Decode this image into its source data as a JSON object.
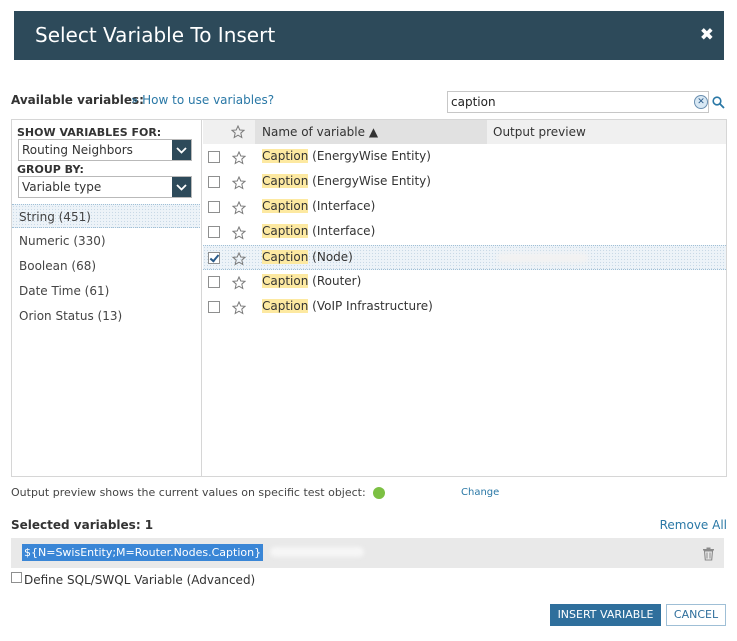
{
  "dialog": {
    "title": "Select Variable To Insert",
    "close_glyph": "✖"
  },
  "available": {
    "label": "Available variables:",
    "help_link": "» How to use variables?"
  },
  "search": {
    "value": "caption",
    "clear_glyph": "✕"
  },
  "left_pane": {
    "show_for_label": "SHOW VARIABLES FOR:",
    "show_for_value": "Routing Neighbors",
    "group_by_label": "GROUP BY:",
    "group_by_value": "Variable type",
    "groups": [
      {
        "label": "String (451)",
        "selected": true
      },
      {
        "label": "Numeric (330)",
        "selected": false
      },
      {
        "label": "Boolean (68)",
        "selected": false
      },
      {
        "label": "Date Time (61)",
        "selected": false
      },
      {
        "label": "Orion Status (13)",
        "selected": false
      }
    ]
  },
  "grid": {
    "col_name": "Name of variable ▲",
    "col_preview": "Output preview",
    "rows": [
      {
        "match": "Caption",
        "rest": " (EnergyWise Entity)",
        "checked": false
      },
      {
        "match": "Caption",
        "rest": " (EnergyWise Entity)",
        "checked": false
      },
      {
        "match": "Caption",
        "rest": " (Interface)",
        "checked": false
      },
      {
        "match": "Caption",
        "rest": " (Interface)",
        "checked": false
      },
      {
        "match": "Caption",
        "rest": " (Node)",
        "checked": true
      },
      {
        "match": "Caption",
        "rest": " (Router)",
        "checked": false
      },
      {
        "match": "Caption",
        "rest": " (VoIP Infrastructure)",
        "checked": false
      }
    ]
  },
  "preview_note": {
    "text": "Output preview shows the current values on specific test object:",
    "status_color": "#7cc043",
    "change_link": "Change"
  },
  "selected": {
    "label": "Selected variables: 1",
    "remove_all": "Remove All",
    "token": "${N=SwisEntity;M=Router.Nodes.Caption}"
  },
  "sql_option": {
    "label": "Define SQL/SWQL Variable (Advanced)",
    "checked": false
  },
  "buttons": {
    "insert": "INSERT VARIABLE",
    "cancel": "CANCEL"
  },
  "colors": {
    "title_bar": "#2d4a5a",
    "accent": "#2f6f9c",
    "link": "#2a78a6",
    "match_highlight": "#fde9a1",
    "selected_token": "#3a86d6"
  }
}
